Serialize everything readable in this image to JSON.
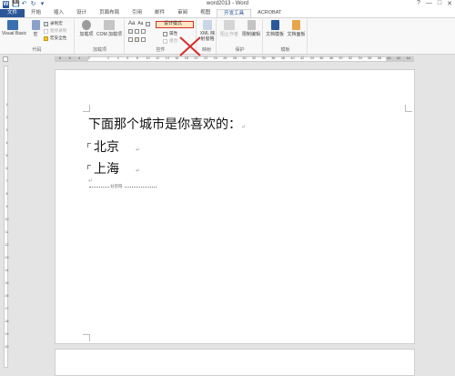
{
  "window": {
    "title": "word2013 - Word",
    "help": "?",
    "minimize": "—",
    "restore": "□",
    "close": "✕"
  },
  "qat": {
    "app_icon": "W",
    "save": "💾",
    "undo": "↶",
    "redo": "↻",
    "more": "▾"
  },
  "tabs": [
    "文件",
    "开始",
    "插入",
    "设计",
    "页面布局",
    "引用",
    "邮件",
    "审阅",
    "视图",
    "开发工具",
    "ACROBAT"
  ],
  "ribbon": {
    "code": {
      "visual_basic": "Visual Basic",
      "macro": "宏",
      "record_macro": "录制宏",
      "pause_recording": "暂停录制",
      "macro_security": "宏安全性",
      "label": "代码"
    },
    "addins": {
      "addins": "加载项",
      "com_addins": "COM 加载项",
      "label": "加载项"
    },
    "controls": {
      "aa1": "Aa",
      "aa2": "Aa",
      "design_mode": "设计模式",
      "properties": "属性",
      "group": "组合",
      "label": "控件"
    },
    "mapping": {
      "xml_pane": "XML 映射窗格",
      "label": "映射"
    },
    "protect": {
      "block_authors": "阻止作者",
      "restrict_editing": "限制编辑",
      "label": "保护"
    },
    "templates": {
      "document_template": "文档模板",
      "document_panel": "文档面板",
      "label": "模板"
    }
  },
  "ruler": {
    "h_ticks": [
      "8",
      "6",
      "4",
      "2",
      "",
      "2",
      "4",
      "6",
      "8",
      "10",
      "12",
      "14",
      "16",
      "18",
      "20",
      "22",
      "24",
      "26",
      "28",
      "30",
      "32",
      "34",
      "36",
      "38",
      "40",
      "42",
      "44",
      "46",
      "48",
      "50",
      "52",
      "54",
      "56",
      "58",
      "60",
      "62",
      "64"
    ],
    "v_ticks": [
      "1",
      "2",
      "3",
      "4",
      "5",
      "6",
      "7",
      "8",
      "9",
      "10",
      "11",
      "12",
      "13",
      "14",
      "15",
      "16",
      "17",
      "18",
      "19",
      "20"
    ]
  },
  "document": {
    "question": "下面那个城市是你喜欢的：",
    "option1": "北京",
    "option2": "上海",
    "pilcrow": "↵",
    "section_break": "分页符"
  }
}
